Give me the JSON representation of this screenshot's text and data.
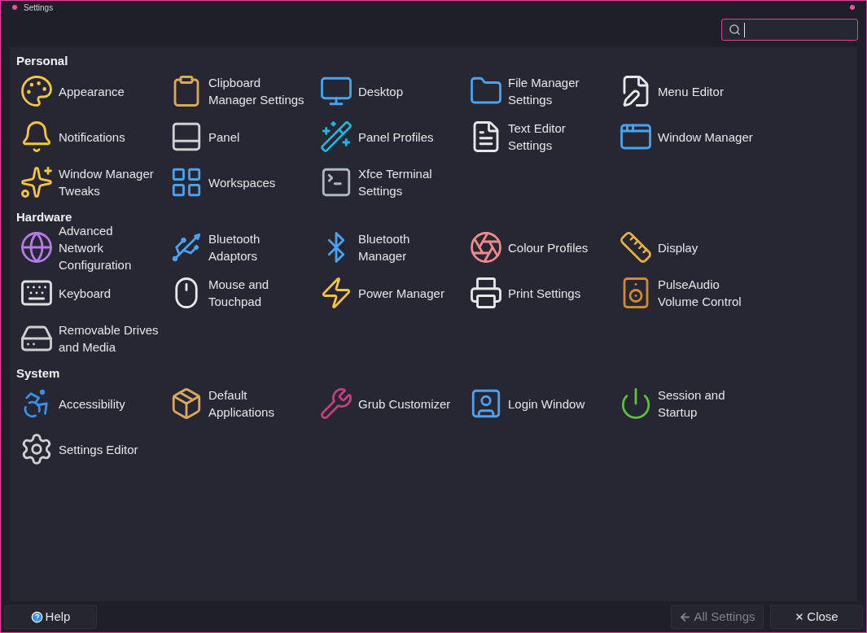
{
  "window": {
    "title": "Settings"
  },
  "sections": [
    {
      "title": "Personal",
      "items": [
        {
          "lines": [
            "Appearance"
          ]
        },
        {
          "lines": [
            "Clipboard",
            "Manager Settings"
          ]
        },
        {
          "lines": [
            "Desktop"
          ]
        },
        {
          "lines": [
            "File Manager",
            "Settings"
          ]
        },
        {
          "lines": [
            "Menu Editor"
          ]
        },
        {
          "lines": [
            "Notifications"
          ]
        },
        {
          "lines": [
            "Panel"
          ]
        },
        {
          "lines": [
            "Panel Profiles"
          ]
        },
        {
          "lines": [
            "Text Editor",
            "Settings"
          ]
        },
        {
          "lines": [
            "Window Manager"
          ]
        },
        {
          "lines": [
            "Window Manager",
            "Tweaks"
          ]
        },
        {
          "lines": [
            "Workspaces"
          ]
        },
        {
          "lines": [
            "Xfce Terminal",
            "Settings"
          ]
        }
      ]
    },
    {
      "title": "Hardware",
      "items": [
        {
          "lines": [
            "Advanced",
            "Network",
            "Configuration"
          ]
        },
        {
          "lines": [
            "Bluetooth",
            "Adaptors"
          ]
        },
        {
          "lines": [
            "Bluetooth",
            "Manager"
          ]
        },
        {
          "lines": [
            "Colour Profiles"
          ]
        },
        {
          "lines": [
            "Display"
          ]
        },
        {
          "lines": [
            "Keyboard"
          ]
        },
        {
          "lines": [
            "Mouse and",
            "Touchpad"
          ]
        },
        {
          "lines": [
            "Power Manager"
          ]
        },
        {
          "lines": [
            "Print Settings"
          ]
        },
        {
          "lines": [
            "PulseAudio",
            "Volume Control"
          ]
        },
        {
          "lines": [
            "Removable Drives",
            "and Media"
          ]
        }
      ]
    },
    {
      "title": "System",
      "items": [
        {
          "lines": [
            "Accessibility"
          ]
        },
        {
          "lines": [
            "Default",
            "Applications"
          ]
        },
        {
          "lines": [
            "Grub Customizer"
          ]
        },
        {
          "lines": [
            "Login Window"
          ]
        },
        {
          "lines": [
            "Session and",
            "Startup"
          ]
        },
        {
          "lines": [
            "Settings Editor"
          ]
        }
      ]
    }
  ],
  "buttons": [
    {
      "label": "Help",
      "kind": "help",
      "disabled": false
    },
    {
      "label": "All Settings",
      "kind": "back",
      "disabled": true
    },
    {
      "label": "Close",
      "kind": "close",
      "disabled": false
    }
  ]
}
